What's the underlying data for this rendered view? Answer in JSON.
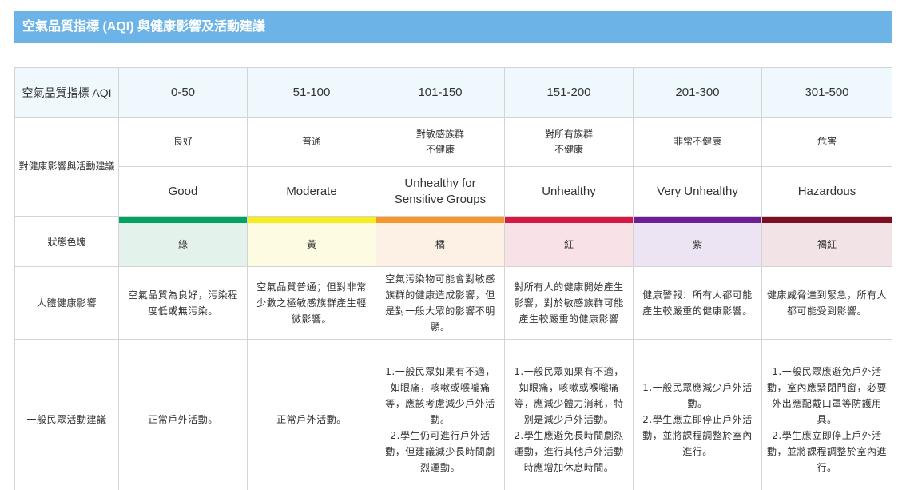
{
  "title": "空氣品質指標 (AQI) 與健康影響及活動建議",
  "labels": {
    "aqi": "空氣品質指標 AQI",
    "health_advice": "對健康影響與活動建議",
    "color_block": "狀態色塊",
    "human_effect": "人體健康影響",
    "public_activity": "一般民眾活動建議"
  },
  "levels": [
    {
      "range": "0-50",
      "zh": "良好",
      "en": "Good",
      "color_name": "綠",
      "stripe_color": "#00a362",
      "chip_color": "#e4f2ec",
      "effect": "空氣品質為良好，污染程度低或無污染。",
      "activity": "正常戶外活動。"
    },
    {
      "range": "51-100",
      "zh": "普通",
      "en": "Moderate",
      "color_name": "黃",
      "stripe_color": "#f6ec1e",
      "chip_color": "#fdfce2",
      "effect": "空氣品質普通；但對非常少數之極敏感族群產生輕微影響。",
      "activity": "正常戶外活動。"
    },
    {
      "range": "101-150",
      "zh": "對敏感族群\n不健康",
      "en": "Unhealthy for Sensitive Groups",
      "color_name": "橘",
      "stripe_color": "#f6962d",
      "chip_color": "#fdf0e4",
      "effect": "空氣污染物可能會對敏感族群的健康造成影響，但是對一般大眾的影響不明顯。",
      "activity": "1.一般民眾如果有不適，如眼痛，咳嗽或喉嚨痛等，應該考慮減少戶外活動。\n2.學生仍可進行戶外活動，但建議減少長時間劇烈運動。"
    },
    {
      "range": "151-200",
      "zh": "對所有族群\n不健康",
      "en": "Unhealthy",
      "color_name": "紅",
      "stripe_color": "#d71843",
      "chip_color": "#f8e2e8",
      "effect": "對所有人的健康開始產生影響，對於敏感族群可能產生較嚴重的健康影響",
      "activity": "1.一般民眾如果有不適，如眼痛，咳嗽或喉嚨痛等，應減少體力消耗，特別是減少戶外活動。\n2.學生應避免長時間劇烈運動，進行其他戶外活動時應增加休息時間。"
    },
    {
      "range": "201-300",
      "zh": "非常不健康",
      "en": "Very Unhealthy",
      "color_name": "紫",
      "stripe_color": "#6b1e96",
      "chip_color": "#ece4f3",
      "effect": "健康警報：所有人都可能產生較嚴重的健康影響。",
      "activity": "1.一般民眾應減少戶外活動。\n2.學生應立即停止戶外活動，並將課程調整於室內進行。"
    },
    {
      "range": "301-500",
      "zh": "危害",
      "en": "Hazardous",
      "color_name": "褐紅",
      "stripe_color": "#7d0f21",
      "chip_color": "#f2e4e6",
      "effect": "健康威脅達到緊急，所有人都可能受到影響。",
      "activity": "1.一般民眾應避免戶外活動，室內應緊閉門窗，必要外出應配戴口罩等防護用具。\n2.學生應立即停止戶外活動，並將課程調整於室內進行。"
    }
  ]
}
